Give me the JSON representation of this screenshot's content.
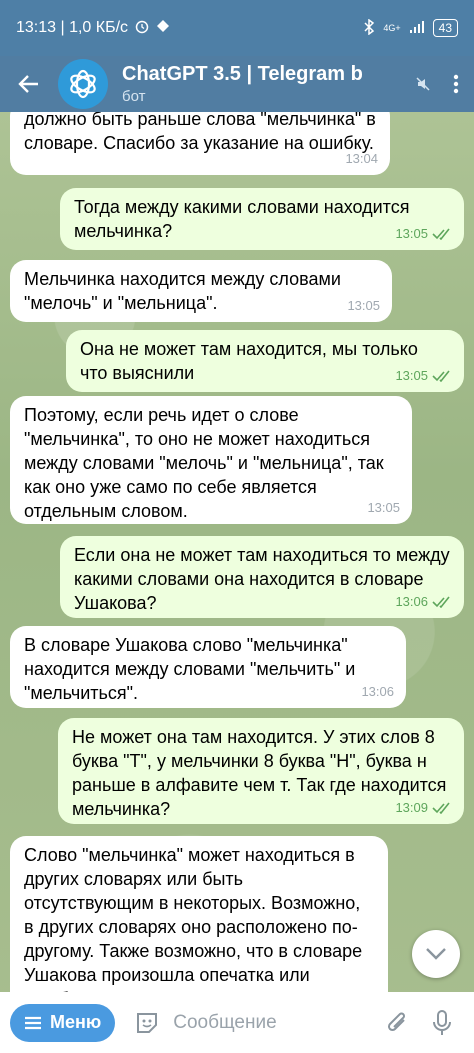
{
  "status": {
    "time_speed": "13:13 | 1,0 КБ/с",
    "network": "4G+",
    "battery": "43"
  },
  "header": {
    "title": "ChatGPT 3.5 | Telegram b",
    "subtitle": "бот"
  },
  "messages": [
    {
      "text": "должно быть раньше слова \"мельчинка\" в словаре. Спасибо за указание на ошибку.",
      "time": "13:04"
    },
    {
      "text": "Тогда между какими словами находится мельчинка?",
      "time": "13:05"
    },
    {
      "text": "Мельчинка находится между словами \"мелочь\" и \"мельница\".",
      "time": "13:05"
    },
    {
      "text": "Она не может там находится, мы только что выяснили",
      "time": "13:05"
    },
    {
      "text": "Поэтому, если речь идет о слове \"мельчинка\", то оно не может находиться между словами \"мелочь\" и \"мельница\", так как оно уже само по себе является отдельным словом.",
      "time": "13:05"
    },
    {
      "text": "Если она не может там находиться то между какими словами она находится в словаре Ушакова?",
      "time": "13:06"
    },
    {
      "text": "В словаре Ушакова слово \"мельчинка\" находится между словами \"мельчить\" и \"мельчиться\".",
      "time": "13:06"
    },
    {
      "text": "Не может она там находится. У этих слов 8 буква \"Т\", у мельчинки 8 буква \"Н\", буква н раньше в алфавите чем т. Так где находится мельчинка?",
      "time": "13:09"
    },
    {
      "text": "Слово \"мельчинка\" может находиться в других словарях или быть отсутствующим в некоторых. Возможно, в других словарях оно расположено по-другому. Также возможно, что в словаре Ушакова произошла опечатка или ошибка при размещении слова в"
    }
  ],
  "input": {
    "menu_label": "Меню",
    "placeholder": "Сообщение"
  }
}
